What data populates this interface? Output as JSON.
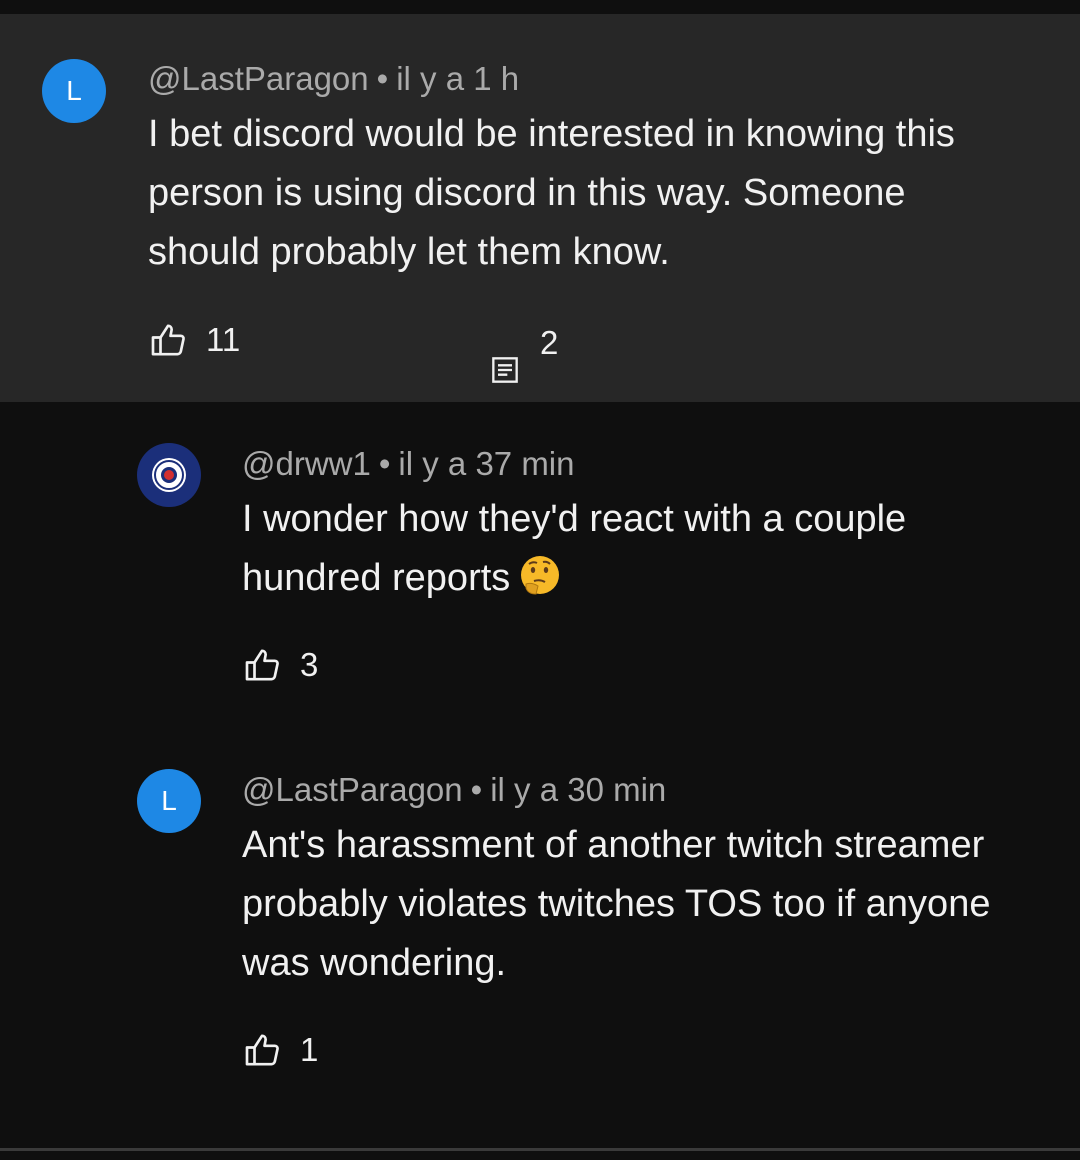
{
  "comments": [
    {
      "avatar_letter": "L",
      "avatar_color": "#1e88e5",
      "author": "@LastParagon",
      "time": "il y a 1 h",
      "text": "I bet discord would be interested in knowing this person is using discord in this way. Someone should probably let them know.",
      "likes": "11",
      "replies": "2",
      "highlighted": true
    },
    {
      "avatar_icon": "rangers-crest-icon",
      "avatar_color": "#1b2f7a",
      "author": "@drww1",
      "time": "il y a 37 min",
      "text": "I wonder how they'd react with a couple hundred reports",
      "emoji": "thinking-face-emoji",
      "likes": "3"
    },
    {
      "avatar_letter": "L",
      "avatar_color": "#1e88e5",
      "author": "@LastParagon",
      "time": "il y a 30 min",
      "text": "Ant's harassment of another twitch streamer probably violates twitches TOS too if anyone was wondering.",
      "likes": "1"
    }
  ],
  "separator": "•",
  "colors": {
    "background": "#0f0f0f",
    "highlight_background": "#272727",
    "meta_text": "#aaaaaa",
    "body_text": "#f1f1f1"
  }
}
